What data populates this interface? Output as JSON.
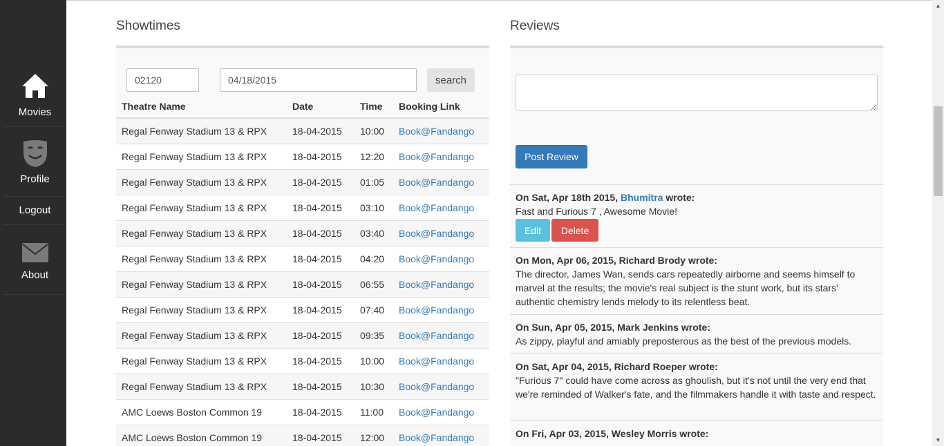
{
  "sidebar": {
    "items": [
      {
        "label": "Movies",
        "icon": "home-icon"
      },
      {
        "label": "Profile",
        "icon": "mask-icon"
      },
      {
        "label": "Logout",
        "icon": ""
      },
      {
        "label": "About",
        "icon": "envelope-icon"
      }
    ]
  },
  "showtimes": {
    "title": "Showtimes",
    "zip_value": "02120",
    "date_value": "04/18/2015",
    "search_label": "search",
    "columns": [
      "Theatre Name",
      "Date",
      "Time",
      "Booking Link"
    ],
    "rows": [
      {
        "theatre": "Regal Fenway Stadium 13 & RPX",
        "date": "18-04-2015",
        "time": "10:00",
        "link": "Book@Fandango"
      },
      {
        "theatre": "Regal Fenway Stadium 13 & RPX",
        "date": "18-04-2015",
        "time": "12:20",
        "link": "Book@Fandango"
      },
      {
        "theatre": "Regal Fenway Stadium 13 & RPX",
        "date": "18-04-2015",
        "time": "01:05",
        "link": "Book@Fandango"
      },
      {
        "theatre": "Regal Fenway Stadium 13 & RPX",
        "date": "18-04-2015",
        "time": "03:10",
        "link": "Book@Fandango"
      },
      {
        "theatre": "Regal Fenway Stadium 13 & RPX",
        "date": "18-04-2015",
        "time": "03:40",
        "link": "Book@Fandango"
      },
      {
        "theatre": "Regal Fenway Stadium 13 & RPX",
        "date": "18-04-2015",
        "time": "04:20",
        "link": "Book@Fandango"
      },
      {
        "theatre": "Regal Fenway Stadium 13 & RPX",
        "date": "18-04-2015",
        "time": "06:55",
        "link": "Book@Fandango"
      },
      {
        "theatre": "Regal Fenway Stadium 13 & RPX",
        "date": "18-04-2015",
        "time": "07:40",
        "link": "Book@Fandango"
      },
      {
        "theatre": "Regal Fenway Stadium 13 & RPX",
        "date": "18-04-2015",
        "time": "09:35",
        "link": "Book@Fandango"
      },
      {
        "theatre": "Regal Fenway Stadium 13 & RPX",
        "date": "18-04-2015",
        "time": "10:00",
        "link": "Book@Fandango"
      },
      {
        "theatre": "Regal Fenway Stadium 13 & RPX",
        "date": "18-04-2015",
        "time": "10:30",
        "link": "Book@Fandango"
      },
      {
        "theatre": "AMC Loews Boston Common 19",
        "date": "18-04-2015",
        "time": "11:00",
        "link": "Book@Fandango"
      },
      {
        "theatre": "AMC Loews Boston Common 19",
        "date": "18-04-2015",
        "time": "12:00",
        "link": "Book@Fandango"
      }
    ]
  },
  "reviews": {
    "title": "Reviews",
    "textarea_value": "",
    "post_label": "Post Review",
    "user_review": {
      "prefix": "On Sat, Apr 18th 2015, ",
      "author": "Bhumitra",
      "suffix": " wrote:",
      "text": "Fast and Furious 7 , Awesome Movie!",
      "edit_label": "Edit",
      "delete_label": "Delete"
    },
    "items": [
      {
        "meta": "On Mon, Apr 06, 2015, Richard Brody wrote:",
        "text": "The director, James Wan, sends cars repeatedly airborne and seems himself to marvel at the results; the movie's real subject is the stunt work, but its stars' authentic chemistry lends melody to its relentless beat."
      },
      {
        "meta": "On Sun, Apr 05, 2015, Mark Jenkins wrote:",
        "text": "As zippy, playful and amiably preposterous as the best of the previous models."
      },
      {
        "meta": "On Sat, Apr 04, 2015, Richard Roeper wrote:",
        "text": "\"Furious 7\" could have come across as ghoulish, but it's not until the very end that we're reminded of Walker's fate, and the filmmakers handle it with taste and respect."
      },
      {
        "meta": "On Fri, Apr 03, 2015, Wesley Morris wrote:",
        "text": ""
      }
    ]
  },
  "colors": {
    "sidebar_bg": "#2b2b2b",
    "link": "#337ab7",
    "primary_button": "#337ab7",
    "edit_button": "#5bc0de",
    "delete_button": "#d9534f"
  }
}
